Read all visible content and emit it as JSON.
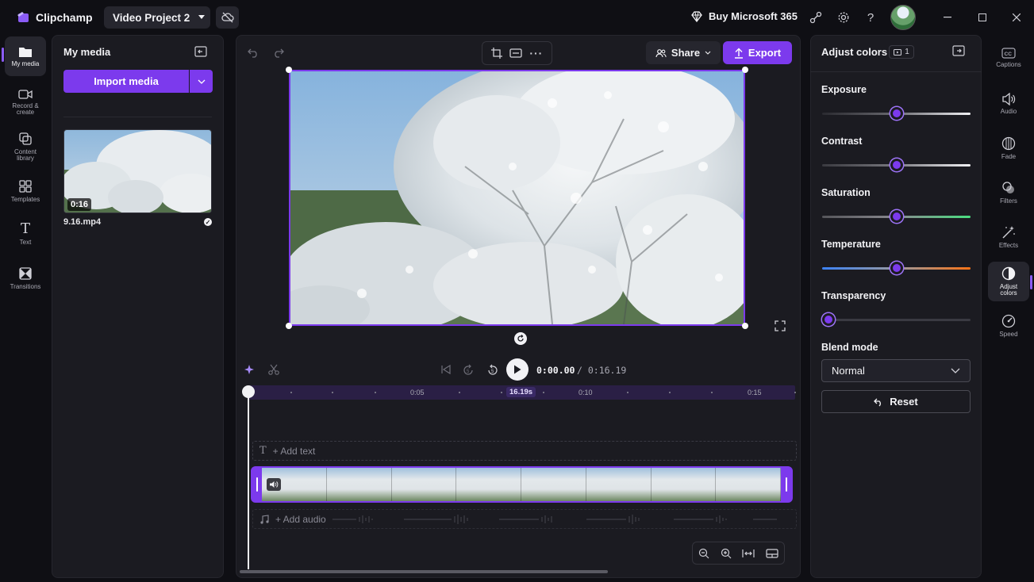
{
  "titlebar": {
    "app_name": "Clipchamp",
    "project_name": "Video Project 2",
    "buy_label": "Buy Microsoft 365"
  },
  "left_rail": {
    "items": [
      {
        "label": "My media",
        "icon": "folder-icon"
      },
      {
        "label": "Record & create",
        "icon": "camera-icon"
      },
      {
        "label": "Content library",
        "icon": "library-icon"
      },
      {
        "label": "Templates",
        "icon": "templates-icon"
      },
      {
        "label": "Text",
        "icon": "text-icon"
      },
      {
        "label": "Transitions",
        "icon": "transitions-icon"
      }
    ]
  },
  "media_panel": {
    "title": "My media",
    "import_label": "Import media",
    "items": [
      {
        "file_name": "9.16.mp4",
        "duration": "0:16"
      }
    ]
  },
  "editor": {
    "share_label": "Share",
    "export_label": "Export",
    "time_current": "0:00.00",
    "time_total": "/ 0:16.19",
    "ruler_labels": [
      "0:05",
      "0:10",
      "0:15"
    ],
    "playhead_badge": "16.19s",
    "add_text_label": "+ Add text",
    "add_audio_label": "+ Add audio"
  },
  "right_panel": {
    "title": "Adjust colors",
    "badge_count": "1",
    "sliders": [
      {
        "label": "Exposure",
        "value": 0.5
      },
      {
        "label": "Contrast",
        "value": 0.5
      },
      {
        "label": "Saturation",
        "value": 0.5
      },
      {
        "label": "Temperature",
        "value": 0.5
      },
      {
        "label": "Transparency",
        "value": 0.0
      }
    ],
    "blend_mode_label": "Blend mode",
    "blend_mode_value": "Normal",
    "reset_label": "Reset"
  },
  "right_rail": {
    "items": [
      {
        "label": "Captions",
        "icon": "captions-icon"
      },
      {
        "label": "Audio",
        "icon": "speaker-icon"
      },
      {
        "label": "Fade",
        "icon": "fade-icon"
      },
      {
        "label": "Filters",
        "icon": "filters-icon"
      },
      {
        "label": "Effects",
        "icon": "effects-icon"
      },
      {
        "label": "Adjust colors",
        "icon": "contrast-icon"
      },
      {
        "label": "Speed",
        "icon": "speed-icon"
      }
    ]
  },
  "colors": {
    "accent": "#7c3aed",
    "background": "#0f0f14",
    "panel": "#1b1b21"
  }
}
